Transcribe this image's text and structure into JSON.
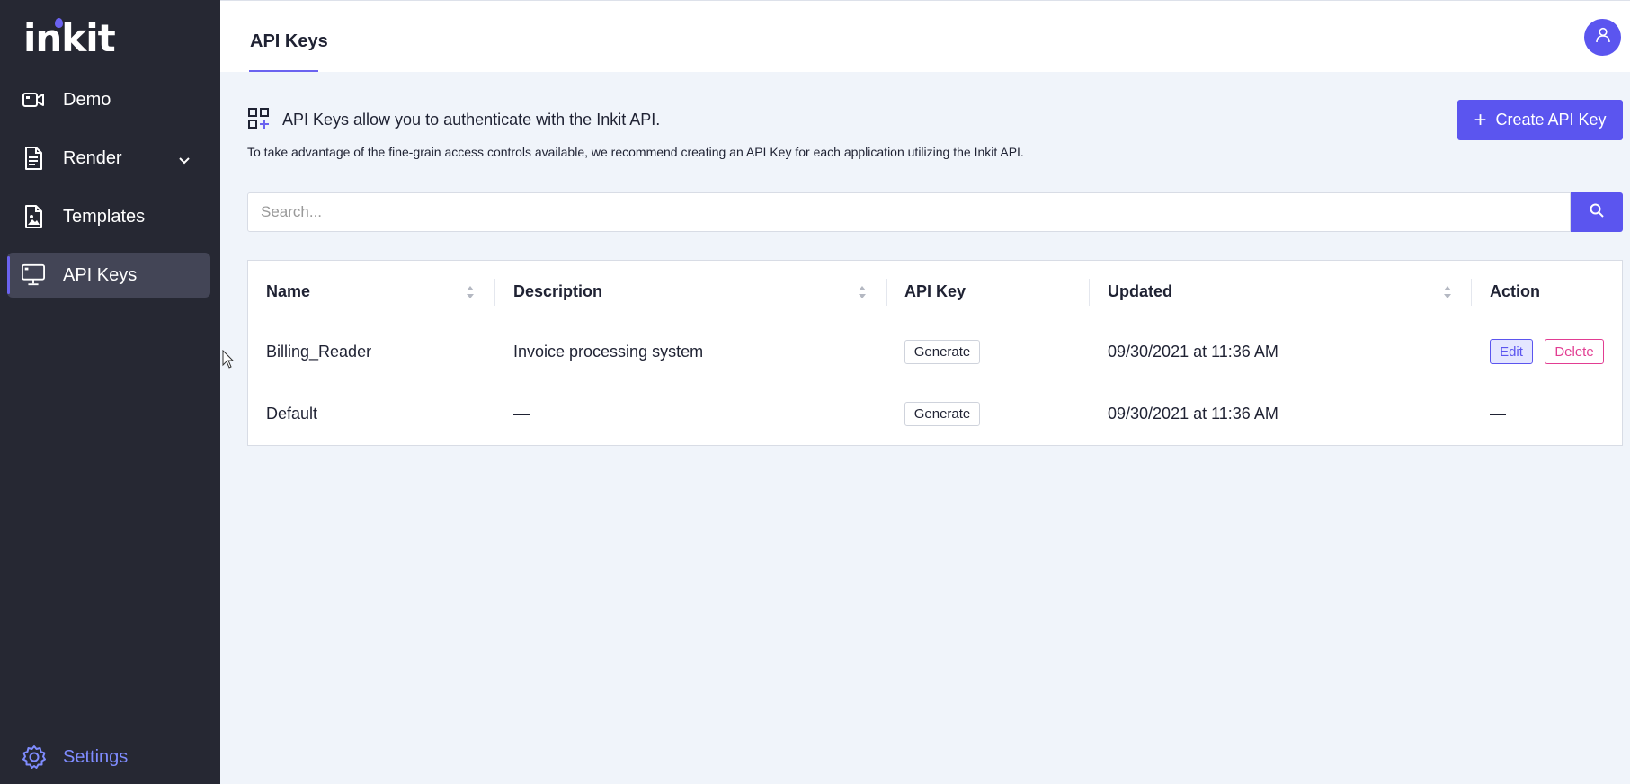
{
  "app": {
    "logo": "inkit"
  },
  "sidebar": {
    "items": [
      {
        "label": "Demo",
        "icon": "video-camera-icon"
      },
      {
        "label": "Render",
        "icon": "document-icon"
      },
      {
        "label": "Templates",
        "icon": "image-file-icon"
      },
      {
        "label": "API Keys",
        "icon": "monitor-icon",
        "active": true
      }
    ],
    "settings": {
      "label": "Settings",
      "icon": "gear-icon"
    }
  },
  "header": {
    "tab": "API Keys",
    "avatar_icon": "user-icon"
  },
  "intro": {
    "text": "API Keys allow you to authenticate with the Inkit API.",
    "subtext": "To take advantage of the fine-grain access controls available, we recommend creating an API Key for each application utilizing the Inkit API."
  },
  "create_button": {
    "label": "Create API Key",
    "icon": "plus-icon"
  },
  "search": {
    "placeholder": "Search...",
    "icon": "search-icon"
  },
  "table": {
    "columns": [
      "Name",
      "Description",
      "API Key",
      "Updated",
      "Action"
    ],
    "rows": [
      {
        "name": "Billing_Reader",
        "description": "Invoice processing system",
        "api_key": "Generate",
        "updated": "09/30/2021 at 11:36 AM",
        "edit": "Edit",
        "delete": "Delete"
      },
      {
        "name": "Default",
        "description": "—",
        "api_key": "Generate",
        "updated": "09/30/2021 at 11:36 AM",
        "action": "—"
      }
    ]
  },
  "colors": {
    "sidebar": "#262833",
    "accent": "#5b55ef",
    "danger": "#e23d92",
    "background": "#f0f4fa"
  }
}
